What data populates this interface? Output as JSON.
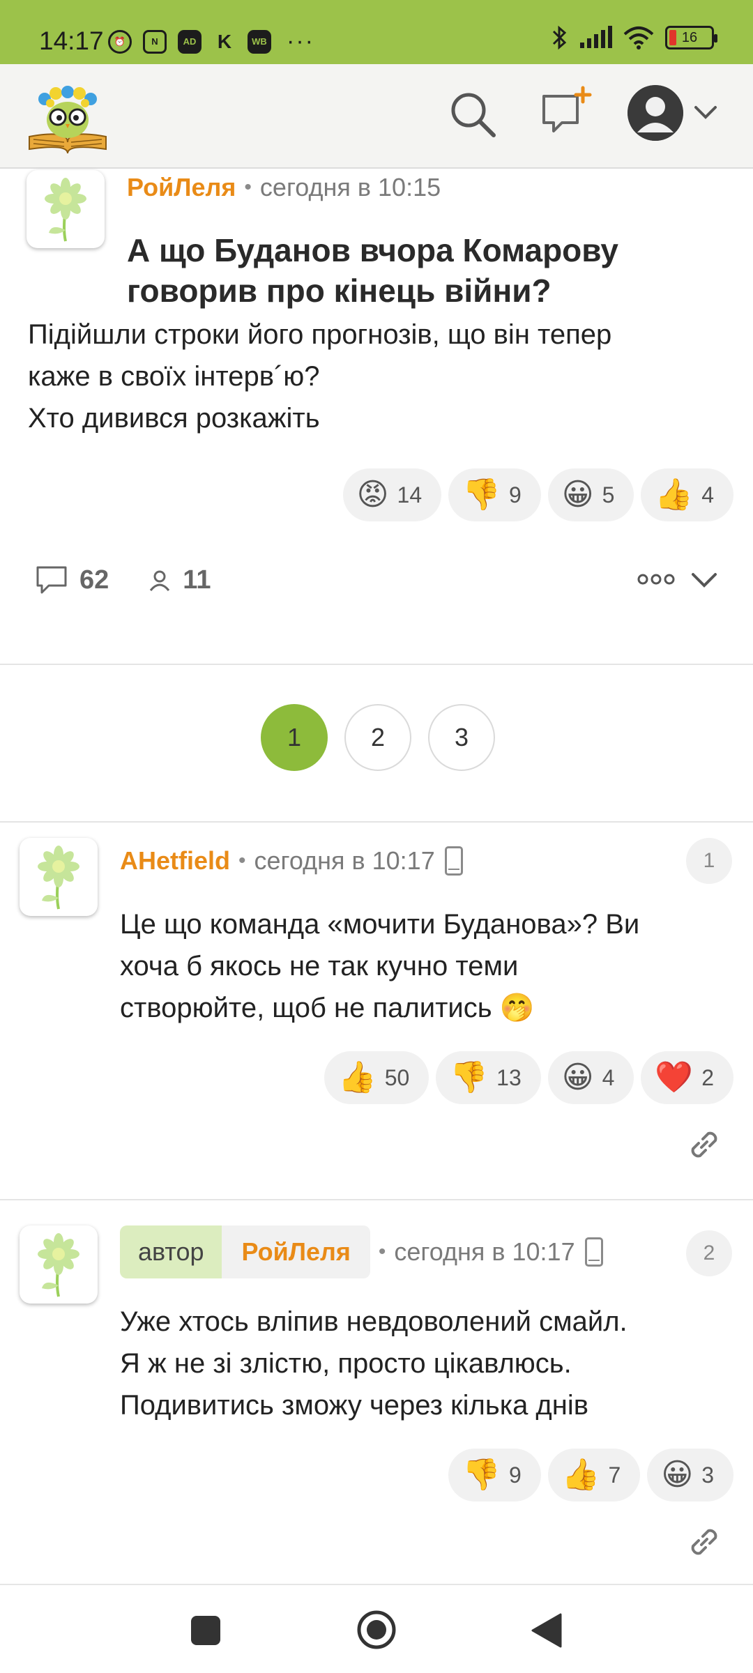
{
  "status_bar": {
    "time": "14:17",
    "battery": "16",
    "left_icons": [
      "alarm-icon",
      "nfc-icon",
      "ad-app-icon",
      "k-app-icon",
      "wb-app-icon"
    ],
    "more": "···"
  },
  "header": {
    "logo_icon": "owl-book-logo",
    "search_icon": "search-icon",
    "new_post_icon": "new-post-icon",
    "avatar_icon": "user-avatar-icon"
  },
  "post": {
    "author": "РойЛеля",
    "date": "сегодня в 10:15",
    "title": "А що Буданов вчора Комарову говорив про кінець війни?",
    "body": [
      "Підійшли строки його прогнозів, що він тепер",
      "каже в своїх інтерв´ю?",
      "Хто дивився розкажіть"
    ],
    "reactions": [
      {
        "emoji": "😡",
        "count": "14"
      },
      {
        "emoji": "👎",
        "count": "9"
      },
      {
        "emoji": "😀",
        "count": "5"
      },
      {
        "emoji": "👍",
        "count": "4"
      }
    ],
    "comments_count": "62",
    "subscribers_count": "11"
  },
  "pagination": {
    "pages": [
      "1",
      "2",
      "3"
    ],
    "current": "1"
  },
  "comments": [
    {
      "author": "AHetfield",
      "date": "сегодня в 10:17",
      "number": "1",
      "body": [
        "Це що команда «мочити Буданова»? Ви",
        "хоча б якось не так кучно теми",
        "створюйте, щоб не палитись 🤭"
      ],
      "reactions": [
        {
          "emoji": "👍",
          "count": "50"
        },
        {
          "emoji": "👎",
          "count": "13"
        },
        {
          "emoji": "😀",
          "count": "4"
        },
        {
          "emoji": "❤️",
          "count": "2"
        }
      ]
    },
    {
      "author_label": "автор",
      "author": "РойЛеля",
      "date": "сегодня в 10:17",
      "number": "2",
      "body": [
        "Уже хтось вліпив невдоволений смайл.",
        "Я ж не зі злістю, просто цікавлюсь.",
        "Подивитись зможу через кілька днів"
      ],
      "reactions": [
        {
          "emoji": "👎",
          "count": "9"
        },
        {
          "emoji": "👍",
          "count": "7"
        },
        {
          "emoji": "😀",
          "count": "3"
        }
      ]
    }
  ]
}
